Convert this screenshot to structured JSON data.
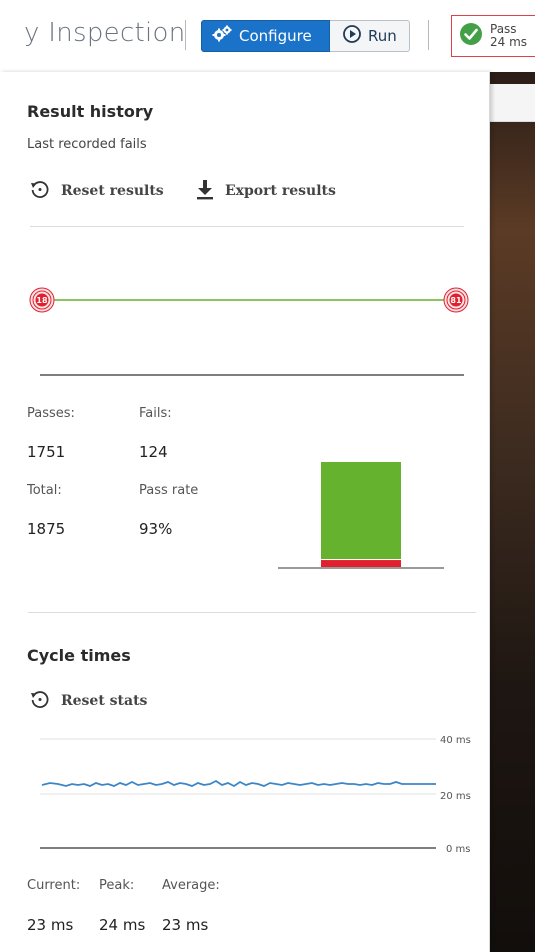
{
  "header": {
    "title": "y Inspection",
    "configure_label": "Configure",
    "run_label": "Run",
    "status_label": "Pass",
    "status_time": "24 ms"
  },
  "result_history": {
    "heading": "Result history",
    "subheading": "Last recorded fails",
    "reset_label": "Reset results",
    "export_label": "Export results",
    "fail_markers": [
      "18",
      "81"
    ]
  },
  "stats": {
    "passes_label": "Passes:",
    "passes_value": "1751",
    "fails_label": "Fails:",
    "fails_value": "124",
    "total_label": "Total:",
    "total_value": "1875",
    "rate_label": "Pass rate",
    "rate_value": "93%"
  },
  "cycle_times": {
    "heading": "Cycle times",
    "reset_label": "Reset stats",
    "axis_labels": [
      "40 ms",
      "20 ms",
      "0 ms"
    ],
    "current_label": "Current:",
    "current_value": "23 ms",
    "peak_label": "Peak:",
    "peak_value": "24 ms",
    "average_label": "Average:",
    "average_value": "23 ms"
  },
  "colors": {
    "pass": "#65b22e",
    "fail": "#e0202f",
    "accent": "#1a73c9",
    "cycle_line": "#3d86c6"
  }
}
